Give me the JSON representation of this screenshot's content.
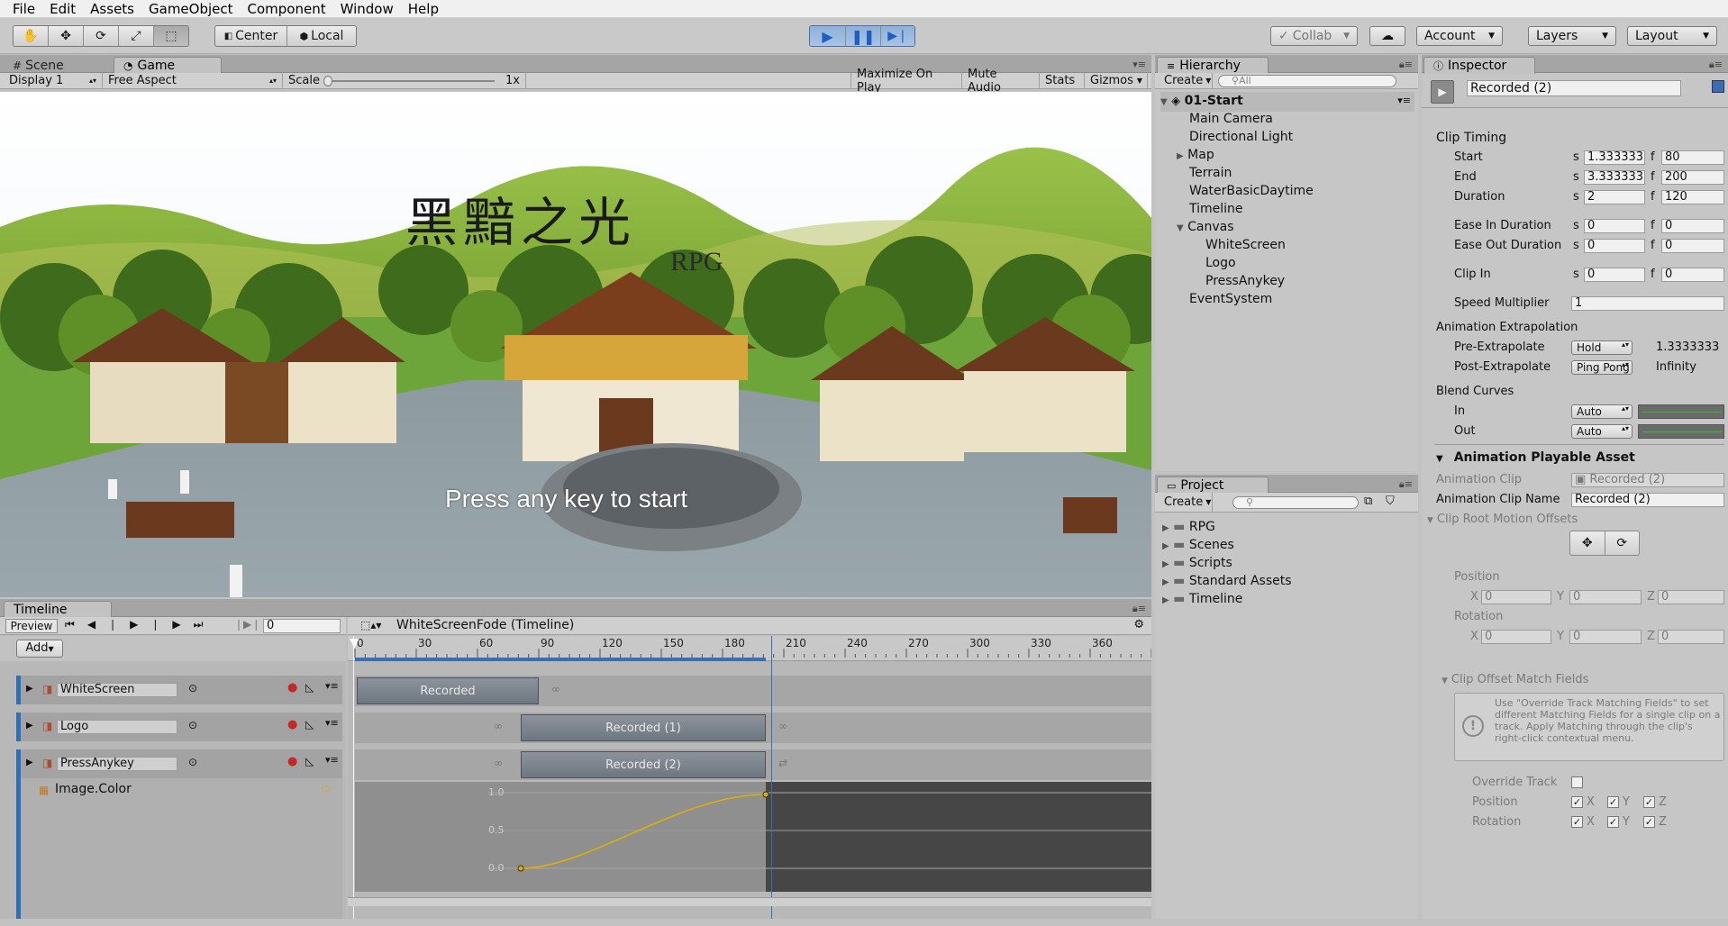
{
  "menu": [
    "File",
    "Edit",
    "Assets",
    "GameObject",
    "Component",
    "Window",
    "Help"
  ],
  "toolbar": {
    "pivot_center": "Center",
    "pivot_local": "Local",
    "collab": "Collab",
    "account": "Account",
    "layers": "Layers",
    "layout": "Layout"
  },
  "game": {
    "tab_scene": "Scene",
    "tab_game": "Game",
    "display": "Display 1",
    "aspect": "Free Aspect",
    "scale_label": "Scale",
    "scale_value": "1x",
    "maximize": "Maximize On Play",
    "mute": "Mute Audio",
    "stats": "Stats",
    "gizmos": "Gizmos",
    "title_cn": "黑黯之光",
    "title_rpg": "RPG",
    "press": "Press any key to start"
  },
  "hierarchy": {
    "tab": "Hierarchy",
    "create": "Create",
    "search": "All",
    "scene": "01-Start",
    "items": [
      "Main Camera",
      "Directional Light",
      "Map",
      "Terrain",
      "WaterBasicDaytime",
      "Timeline",
      "Canvas",
      "WhiteScreen",
      "Logo",
      "PressAnykey",
      "EventSystem"
    ]
  },
  "project": {
    "tab": "Project",
    "create": "Create",
    "folders": [
      "RPG",
      "Scenes",
      "Scripts",
      "Standard Assets",
      "Timeline"
    ]
  },
  "timeline": {
    "tab": "Timeline",
    "preview": "Preview",
    "frame": "0",
    "asset": "WhiteScreenFode (Timeline)",
    "add": "Add",
    "ruler": [
      "0",
      "30",
      "60",
      "90",
      "120",
      "150",
      "180",
      "210",
      "240",
      "270",
      "300",
      "330",
      "360"
    ],
    "tracks": [
      {
        "name": "WhiteScreen",
        "clip": "Recorded"
      },
      {
        "name": "Logo",
        "clip": "Recorded (1)"
      },
      {
        "name": "PressAnykey",
        "clip": "Recorded (2)"
      }
    ],
    "property": "Image.Color",
    "curve_labels": [
      "1.0",
      "0.5",
      "0.0"
    ]
  },
  "inspector": {
    "tab": "Inspector",
    "name": "Recorded (2)",
    "clip_timing": "Clip Timing",
    "start_label": "Start",
    "start_s": "1.333333",
    "start_f": "80",
    "end_label": "End",
    "end_s": "3.333333",
    "end_f": "200",
    "duration_label": "Duration",
    "duration_s": "2",
    "duration_f": "120",
    "ease_in_label": "Ease In Duration",
    "ease_in_s": "0",
    "ease_in_f": "0",
    "ease_out_label": "Ease Out Duration",
    "ease_out_s": "0",
    "ease_out_f": "0",
    "clip_in_label": "Clip In",
    "clip_in_s": "0",
    "clip_in_f": "0",
    "s": "s",
    "f": "f",
    "speed_label": "Speed Multiplier",
    "speed": "1",
    "anim_extrap": "Animation Extrapolation",
    "pre_label": "Pre-Extrapolate",
    "pre_value": "Hold",
    "pre_time": "1.3333333",
    "post_label": "Post-Extrapolate",
    "post_value": "Ping Pong",
    "post_time": "Infinity",
    "blend_curves": "Blend Curves",
    "in_label": "In",
    "in_value": "Auto",
    "out_label": "Out",
    "out_value": "Auto",
    "playable": "Animation Playable Asset",
    "anim_clip_label": "Animation Clip",
    "anim_clip_value": "Recorded (2)",
    "anim_clip_name_label": "Animation Clip Name",
    "anim_clip_name_value": "Recorded (2)",
    "root_motion": "Clip Root Motion Offsets",
    "position_label": "Position",
    "rotation_label": "Rotation",
    "x": "X",
    "y": "Y",
    "z": "Z",
    "zero": "0",
    "match_fields": "Clip Offset Match Fields",
    "help": "Use \"Override Track Matching Fields\" to set different Matching Fields for a single clip on a track. Apply Matching through the clip's right-click contextual menu.",
    "override": "Override Track",
    "pos2_label": "Position",
    "rot2_label": "Rotation"
  }
}
